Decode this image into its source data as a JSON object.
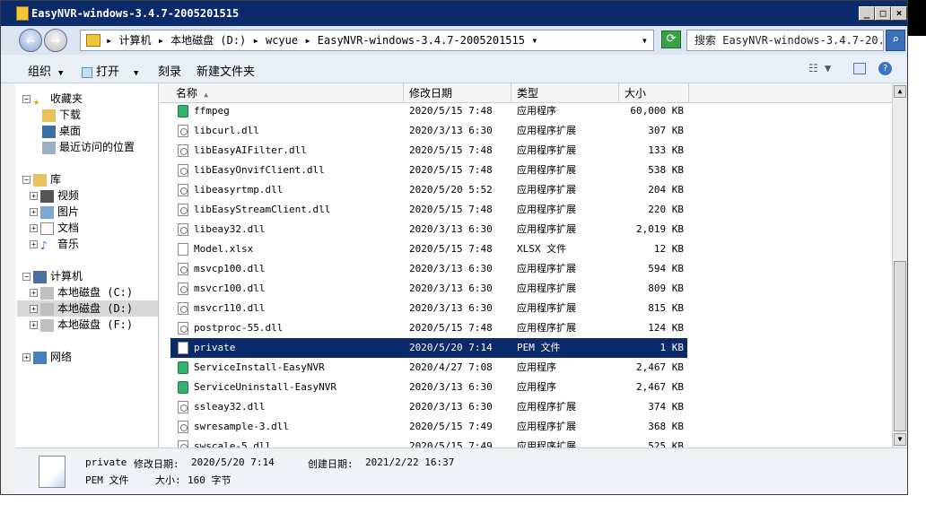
{
  "window": {
    "title": "EasyNVR-windows-3.4.7-2005201515",
    "controls": {
      "min": "_",
      "max": "□",
      "close": "×"
    }
  },
  "address": {
    "breadcrumb": [
      "计算机",
      "本地磁盘 (D:)",
      "wcyue",
      "EasyNVR-windows-3.4.7-2005201515"
    ],
    "search_placeholder": "搜索 EasyNVR-windows-3.4.7-20..."
  },
  "toolbar": {
    "organize": "组织",
    "open": "打开",
    "burn": "刻录",
    "new_folder": "新建文件夹"
  },
  "nav": {
    "favorites": {
      "label": "收藏夹",
      "items": [
        "下载",
        "桌面",
        "最近访问的位置"
      ]
    },
    "libraries": {
      "label": "库",
      "items": [
        "视频",
        "图片",
        "文档",
        "音乐"
      ]
    },
    "computer": {
      "label": "计算机",
      "items": [
        "本地磁盘 (C:)",
        "本地磁盘 (D:)",
        "本地磁盘 (F:)"
      ]
    },
    "network": {
      "label": "网络"
    }
  },
  "columns": {
    "name": "名称",
    "date": "修改日期",
    "type": "类型",
    "size": "大小"
  },
  "files": [
    {
      "name": "ffmpeg",
      "date": "2020/5/15 7:48",
      "type": "应用程序",
      "size": "60,000 KB",
      "kind": "exe"
    },
    {
      "name": "libcurl.dll",
      "date": "2020/3/13 6:30",
      "type": "应用程序扩展",
      "size": "307 KB",
      "kind": "dll"
    },
    {
      "name": "libEasyAIFilter.dll",
      "date": "2020/5/15 7:48",
      "type": "应用程序扩展",
      "size": "133 KB",
      "kind": "dll"
    },
    {
      "name": "libEasyOnvifClient.dll",
      "date": "2020/5/15 7:48",
      "type": "应用程序扩展",
      "size": "538 KB",
      "kind": "dll"
    },
    {
      "name": "libeasyrtmp.dll",
      "date": "2020/5/20 5:52",
      "type": "应用程序扩展",
      "size": "204 KB",
      "kind": "dll"
    },
    {
      "name": "libEasyStreamClient.dll",
      "date": "2020/5/15 7:48",
      "type": "应用程序扩展",
      "size": "220 KB",
      "kind": "dll"
    },
    {
      "name": "libeay32.dll",
      "date": "2020/3/13 6:30",
      "type": "应用程序扩展",
      "size": "2,019 KB",
      "kind": "dll"
    },
    {
      "name": "Model.xlsx",
      "date": "2020/5/15 7:48",
      "type": "XLSX 文件",
      "size": "12 KB",
      "kind": "doc"
    },
    {
      "name": "msvcp100.dll",
      "date": "2020/3/13 6:30",
      "type": "应用程序扩展",
      "size": "594 KB",
      "kind": "dll"
    },
    {
      "name": "msvcr100.dll",
      "date": "2020/3/13 6:30",
      "type": "应用程序扩展",
      "size": "809 KB",
      "kind": "dll"
    },
    {
      "name": "msvcr110.dll",
      "date": "2020/3/13 6:30",
      "type": "应用程序扩展",
      "size": "815 KB",
      "kind": "dll"
    },
    {
      "name": "postproc-55.dll",
      "date": "2020/5/15 7:48",
      "type": "应用程序扩展",
      "size": "124 KB",
      "kind": "dll"
    },
    {
      "name": "private",
      "date": "2020/5/20 7:14",
      "type": "PEM 文件",
      "size": "1 KB",
      "kind": "doc",
      "selected": true
    },
    {
      "name": "ServiceInstall-EasyNVR",
      "date": "2020/4/27 7:08",
      "type": "应用程序",
      "size": "2,467 KB",
      "kind": "exe"
    },
    {
      "name": "ServiceUninstall-EasyNVR",
      "date": "2020/3/13 6:30",
      "type": "应用程序",
      "size": "2,467 KB",
      "kind": "exe"
    },
    {
      "name": "ssleay32.dll",
      "date": "2020/3/13 6:30",
      "type": "应用程序扩展",
      "size": "374 KB",
      "kind": "dll"
    },
    {
      "name": "swresample-3.dll",
      "date": "2020/5/15 7:49",
      "type": "应用程序扩展",
      "size": "368 KB",
      "kind": "dll"
    },
    {
      "name": "swscale-5.dll",
      "date": "2020/5/15 7:49",
      "type": "应用程序扩展",
      "size": "525 KB",
      "kind": "dll"
    }
  ],
  "details": {
    "name": "private",
    "modified_label": "修改日期:",
    "modified": "2020/5/20 7:14",
    "created_label": "创建日期:",
    "created": "2021/2/22 16:37",
    "type": "PEM 文件",
    "size_label": "大小:",
    "size": "160 字节"
  },
  "colors": {
    "title_bar": "#0b2a6b",
    "selection": "#0b2a6b"
  }
}
